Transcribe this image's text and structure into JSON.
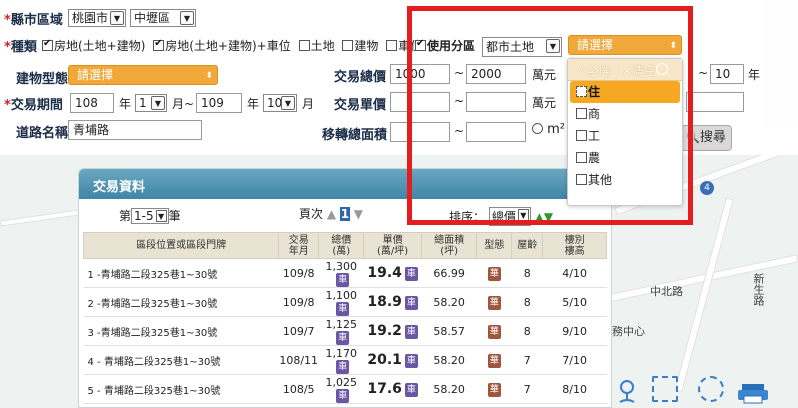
{
  "form": {
    "county_label": "縣市區域",
    "county_value": "桃園市",
    "district_value": "中壢區",
    "type_label": "種類",
    "types": [
      {
        "label": "房地(土地+建物)",
        "checked": true
      },
      {
        "label": "房地(土地+建物)+車位",
        "checked": true
      },
      {
        "label": "土地",
        "checked": false
      },
      {
        "label": "建物",
        "checked": false
      },
      {
        "label": "車位",
        "checked": false
      }
    ],
    "zoning_label": "使用分區",
    "zoning_checked": true,
    "zoning_value": "都市土地",
    "zoning_detail_placeholder": "請選擇",
    "building_type_label": "建物型態",
    "building_type_placeholder": "請選擇",
    "total_price_label": "交易總價",
    "total_price_from": "1000",
    "total_price_to": "2000",
    "total_price_unit": "萬元",
    "age_to": "10",
    "age_unit": "年",
    "period_label": "交易期間",
    "period_from_year": "108",
    "year_text": "年",
    "period_from_month": "1",
    "month_tilde_text": "月~",
    "period_to_year": "109",
    "period_to_month": "10",
    "month_text": "月",
    "unit_price_label": "交易單價",
    "unit_price_unit": "萬元",
    "road_label": "道路名稱",
    "road_value": "青埔路",
    "area_label": "移轉總面積",
    "area_unit": "m²",
    "tilde": "~",
    "search_button": "搜尋"
  },
  "popup": {
    "select_all": "全選",
    "clear": "清空",
    "options": [
      {
        "label": "住",
        "highlighted": true
      },
      {
        "label": "商",
        "highlighted": false
      },
      {
        "label": "工",
        "highlighted": false
      },
      {
        "label": "農",
        "highlighted": false
      },
      {
        "label": "其他",
        "highlighted": false
      }
    ]
  },
  "panel": {
    "title": "交易資料",
    "page_prefix": "第",
    "page_value": "1-5",
    "page_suffix": "筆",
    "page_nav_label": "頁次",
    "page_current": "1",
    "sort_label": "排序：",
    "sort_value": "總價",
    "headers": [
      "區段位置或區段門牌",
      "交易\n年月",
      "總價\n(萬)",
      "單價\n(萬/坪)",
      "總面積\n(坪)",
      "型態",
      "屋齡",
      "樓別\n樓高"
    ],
    "rows": [
      {
        "addr": "1 -青埔路二段325巷1~30號",
        "ym": "109/8",
        "total": "1,300",
        "unit": "19.4",
        "area": "66.99",
        "age": "8",
        "floor": "4/10"
      },
      {
        "addr": "2 -青埔路二段325巷1~30號",
        "ym": "109/8",
        "total": "1,100",
        "unit": "18.9",
        "area": "58.20",
        "age": "8",
        "floor": "5/10"
      },
      {
        "addr": "3 -青埔路二段325巷1~30號",
        "ym": "109/7",
        "total": "1,125",
        "unit": "19.2",
        "area": "58.57",
        "age": "8",
        "floor": "9/10"
      },
      {
        "addr": "4 - 青埔路二段325巷1~30號",
        "ym": "108/11",
        "total": "1,170",
        "unit": "20.1",
        "area": "58.20",
        "age": "7",
        "floor": "7/10"
      },
      {
        "addr": "5 - 青埔路二段325巷1~30號",
        "ym": "108/5",
        "total": "1,025",
        "unit": "17.6",
        "area": "58.20",
        "age": "7",
        "floor": "8/10"
      }
    ],
    "car_tag": "車",
    "type_tag": "華"
  },
  "map": {
    "labels": [
      "中北路",
      "務中心",
      "新生路"
    ],
    "pin": "4"
  },
  "colors": {
    "highlight_frame": "#e41e1e",
    "orange_select": "#f0a83a",
    "panel_header": "#3f86a6",
    "required_star": "#d52020"
  }
}
